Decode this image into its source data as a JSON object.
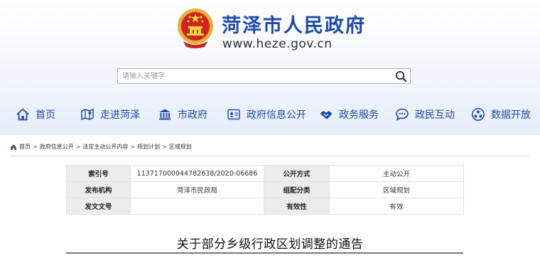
{
  "header": {
    "site_title": "菏泽市人民政府",
    "site_url": "www.heze.gov.cn",
    "emblem_icon": "national-emblem-icon"
  },
  "search": {
    "placeholder": "请输入关键字",
    "icon": "search-icon"
  },
  "nav": {
    "items": [
      {
        "label": "首页",
        "icon": "home-icon"
      },
      {
        "label": "走进菏泽",
        "icon": "map-icon"
      },
      {
        "label": "市政府",
        "icon": "building-icon"
      },
      {
        "label": "政府信息公开",
        "icon": "info-card-icon"
      },
      {
        "label": "政务服务",
        "icon": "handshake-icon"
      },
      {
        "label": "政民互动",
        "icon": "chat-icon"
      },
      {
        "label": "数据开放",
        "icon": "data-cluster-icon"
      }
    ],
    "color": "#1f4aa8"
  },
  "breadcrumb": {
    "items": [
      "首页",
      "政府信息公开",
      "法定主动公开内容",
      "规划计划",
      "区域规划"
    ],
    "separator": ">"
  },
  "meta_table": {
    "rows": [
      [
        {
          "k": "索引号"
        },
        {
          "v": "113717000044782638/2020-06686"
        },
        {
          "k": "公开方式"
        },
        {
          "v": "主动公开"
        }
      ],
      [
        {
          "k": "发布机构"
        },
        {
          "v": "菏泽市民政局"
        },
        {
          "k": "组配分类"
        },
        {
          "v": "区域规划"
        }
      ],
      [
        {
          "k": "发文文号"
        },
        {
          "v": ""
        },
        {
          "k": "有效性"
        },
        {
          "v": "有效"
        }
      ]
    ]
  },
  "document": {
    "title": "关于部分乡级行政区划调整的通告"
  }
}
